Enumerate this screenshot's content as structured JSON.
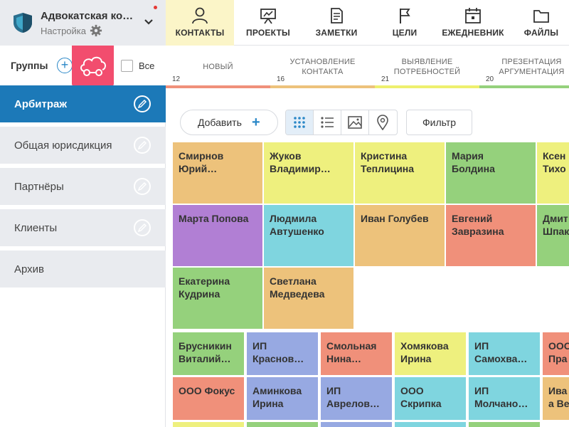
{
  "org": {
    "title": "Адвокатская кон…",
    "subtitle": "Настройка"
  },
  "nav": [
    {
      "label": "КОНТАКТЫ",
      "icon": "person-icon",
      "active": true
    },
    {
      "label": "ПРОЕКТЫ",
      "icon": "presentation-icon",
      "active": false
    },
    {
      "label": "ЗАМЕТКИ",
      "icon": "note-icon",
      "active": false
    },
    {
      "label": "ЦЕЛИ",
      "icon": "flag-icon",
      "active": false
    },
    {
      "label": "ЕЖЕДНЕВНИК",
      "icon": "calendar-icon",
      "active": false
    },
    {
      "label": "ФАЙЛЫ",
      "icon": "folder-icon",
      "active": false
    }
  ],
  "groups": {
    "label": "Группы",
    "all_label": "Все",
    "items": [
      {
        "name": "Арбитраж",
        "active": true
      },
      {
        "name": "Общая юрисдикция",
        "active": false
      },
      {
        "name": "Партнёры",
        "active": false
      },
      {
        "name": "Клиенты",
        "active": false
      },
      {
        "name": "Архив",
        "active": false
      }
    ]
  },
  "stages": [
    {
      "name": "НОВЫЙ",
      "count": "12",
      "color": "#f0907a"
    },
    {
      "name": "УСТАНОВЛЕНИЕ КОНТАКТА",
      "count": "16",
      "color": "#edc27b"
    },
    {
      "name": "ВЫЯВЛЕНИЕ ПОТРЕБНОСТЕЙ",
      "count": "21",
      "color": "#eef06e"
    },
    {
      "name": "ПРЕЗЕНТАЦИЯ АРГУМЕНТАЦИЯ",
      "count": "20",
      "color": "#95d17c"
    }
  ],
  "toolbar": {
    "add_label": "Добавить",
    "add_plus": "+",
    "filter_label": "Фильтр"
  },
  "colors": {
    "orange": "#edc27b",
    "yellow": "#eef07e",
    "green": "#95d17c",
    "purple": "#b17fd4",
    "cyan": "#7fd5df",
    "salmon": "#f0907a",
    "blue": "#97a9e2"
  },
  "cards": [
    {
      "lines": [
        "Смирнов",
        "Юрий…"
      ],
      "color": "orange"
    },
    {
      "lines": [
        "Жуков",
        "Владимир…"
      ],
      "color": "yellow"
    },
    {
      "lines": [
        "Кристина",
        "Теплицина"
      ],
      "color": "yellow"
    },
    {
      "lines": [
        "Мария",
        "Болдина"
      ],
      "color": "green"
    },
    {
      "lines": [
        "Ксен",
        "Тихо"
      ],
      "color": "yellow"
    },
    {
      "lines": [
        "Марта Попова"
      ],
      "color": "purple"
    },
    {
      "lines": [
        "Людмила",
        "Автушенко"
      ],
      "color": "cyan"
    },
    {
      "lines": [
        "Иван Голубев"
      ],
      "color": "orange"
    },
    {
      "lines": [
        "Евгений",
        "Завразина"
      ],
      "color": "salmon"
    },
    {
      "lines": [
        "Дмит",
        "Шпак"
      ],
      "color": "green"
    },
    {
      "lines": [
        "Екатерина",
        "Кудрина"
      ],
      "color": "green"
    },
    {
      "lines": [
        "Светлана",
        "Медведева"
      ],
      "color": "orange"
    },
    {
      "lines": [
        "Брусникин",
        "Виталий…"
      ],
      "color": "green"
    },
    {
      "lines": [
        "ИП",
        "Краснов…"
      ],
      "color": "blue"
    },
    {
      "lines": [
        "Смольная",
        "Нина…"
      ],
      "color": "salmon"
    },
    {
      "lines": [
        "Хомякова",
        "Ирина"
      ],
      "color": "yellow"
    },
    {
      "lines": [
        "ИП",
        "Самохва…"
      ],
      "color": "cyan"
    },
    {
      "lines": [
        "ООО",
        "Пра"
      ],
      "color": "salmon"
    },
    {
      "lines": [
        "ООО Фокус"
      ],
      "color": "salmon"
    },
    {
      "lines": [
        "Аминкова",
        "Ирина"
      ],
      "color": "blue"
    },
    {
      "lines": [
        "ИП",
        "Аврелов…"
      ],
      "color": "blue"
    },
    {
      "lines": [
        "ООО",
        "Скрипка"
      ],
      "color": "cyan"
    },
    {
      "lines": [
        "ИП",
        "Молчано…"
      ],
      "color": "cyan"
    },
    {
      "lines": [
        "Ива",
        "а Ве"
      ],
      "color": "orange"
    },
    {
      "lines": [],
      "color": "yellow"
    },
    {
      "lines": [],
      "color": "green"
    },
    {
      "lines": [],
      "color": "blue"
    },
    {
      "lines": [],
      "color": "cyan"
    },
    {
      "lines": [],
      "color": "green"
    }
  ]
}
